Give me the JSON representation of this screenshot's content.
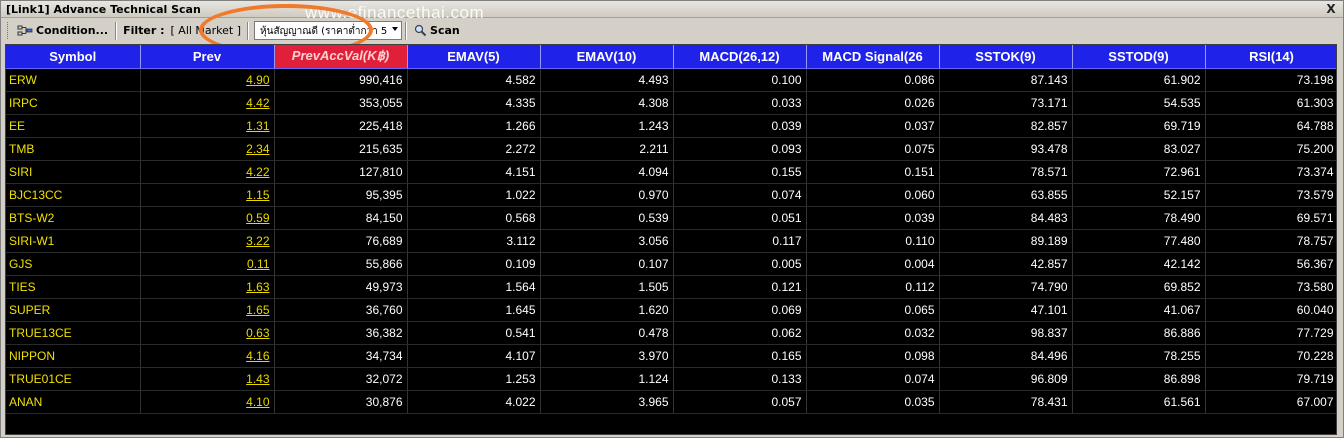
{
  "window": {
    "title": "[Link1] Advance Technical Scan",
    "close_label": "X"
  },
  "toolbar": {
    "condition_label": "Condition...",
    "filter_label": "Filter :",
    "filter_value": "[ All Market ]",
    "select_value": "หุ้นสัญญาณดี (ราคาต่ำกว่า 5",
    "scan_label": "Scan"
  },
  "watermark": "www.efinancethai.com",
  "colors": {
    "header_bg": "#1f22e8",
    "sorted_header_bg": "#e0203a",
    "symbol_color": "#f0e000",
    "highlight_ring": "#f07a2a"
  },
  "table": {
    "columns": [
      "Symbol",
      "Prev",
      "PrevAccVal(K฿)",
      "EMAV(5)",
      "EMAV(10)",
      "MACD(26,12)",
      "MACD Signal(26",
      "SSTOK(9)",
      "SSTOD(9)",
      "RSI(14)"
    ],
    "rows": [
      [
        "ERW",
        "4.90",
        "990,416",
        "4.582",
        "4.493",
        "0.100",
        "0.086",
        "87.143",
        "61.902",
        "73.198"
      ],
      [
        "IRPC",
        "4.42",
        "353,055",
        "4.335",
        "4.308",
        "0.033",
        "0.026",
        "73.171",
        "54.535",
        "61.303"
      ],
      [
        "EE",
        "1.31",
        "225,418",
        "1.266",
        "1.243",
        "0.039",
        "0.037",
        "82.857",
        "69.719",
        "64.788"
      ],
      [
        "TMB",
        "2.34",
        "215,635",
        "2.272",
        "2.211",
        "0.093",
        "0.075",
        "93.478",
        "83.027",
        "75.200"
      ],
      [
        "SIRI",
        "4.22",
        "127,810",
        "4.151",
        "4.094",
        "0.155",
        "0.151",
        "78.571",
        "72.961",
        "73.374"
      ],
      [
        "BJC13CC",
        "1.15",
        "95,395",
        "1.022",
        "0.970",
        "0.074",
        "0.060",
        "63.855",
        "52.157",
        "73.579"
      ],
      [
        "BTS-W2",
        "0.59",
        "84,150",
        "0.568",
        "0.539",
        "0.051",
        "0.039",
        "84.483",
        "78.490",
        "69.571"
      ],
      [
        "SIRI-W1",
        "3.22",
        "76,689",
        "3.112",
        "3.056",
        "0.117",
        "0.110",
        "89.189",
        "77.480",
        "78.757"
      ],
      [
        "GJS",
        "0.11",
        "55,866",
        "0.109",
        "0.107",
        "0.005",
        "0.004",
        "42.857",
        "42.142",
        "56.367"
      ],
      [
        "TIES",
        "1.63",
        "49,973",
        "1.564",
        "1.505",
        "0.121",
        "0.112",
        "74.790",
        "69.852",
        "73.580"
      ],
      [
        "SUPER",
        "1.65",
        "36,760",
        "1.645",
        "1.620",
        "0.069",
        "0.065",
        "47.101",
        "41.067",
        "60.040"
      ],
      [
        "TRUE13CE",
        "0.63",
        "36,382",
        "0.541",
        "0.478",
        "0.062",
        "0.032",
        "98.837",
        "86.886",
        "77.729"
      ],
      [
        "NIPPON",
        "4.16",
        "34,734",
        "4.107",
        "3.970",
        "0.165",
        "0.098",
        "84.496",
        "78.255",
        "70.228"
      ],
      [
        "TRUE01CE",
        "1.43",
        "32,072",
        "1.253",
        "1.124",
        "0.133",
        "0.074",
        "96.809",
        "86.898",
        "79.719"
      ],
      [
        "ANAN",
        "4.10",
        "30,876",
        "4.022",
        "3.965",
        "0.057",
        "0.035",
        "78.431",
        "61.561",
        "67.007"
      ]
    ]
  }
}
